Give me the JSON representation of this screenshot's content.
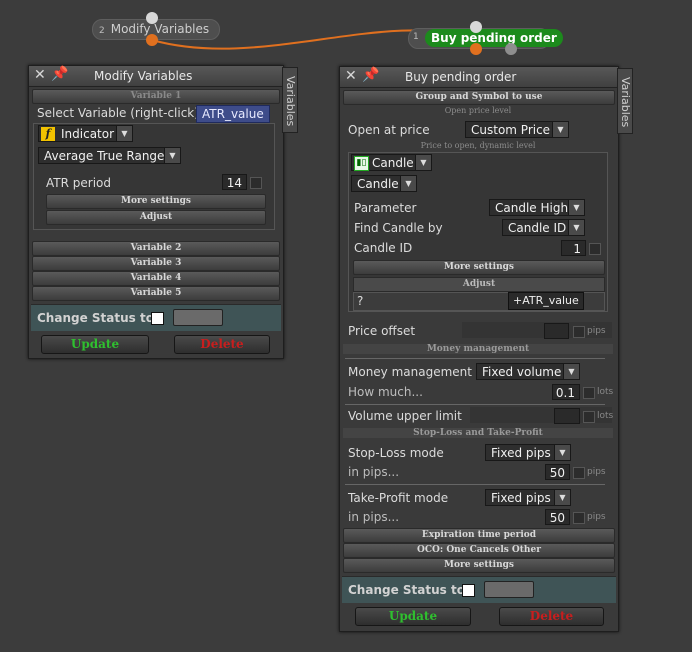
{
  "nodes": {
    "modify": {
      "number": "2",
      "label": "Modify Variables"
    },
    "buy": {
      "number": "1",
      "label": "Buy pending order"
    }
  },
  "modify_panel": {
    "title": "Modify Variables",
    "side_tab": "Variables",
    "var1_header": "Variable 1",
    "select_label": "Select Variable (right-click)",
    "selected_variable": "ATR_value",
    "source_dropdown": "Indicator",
    "indicator_dropdown": "Average True Range",
    "atr_period_label": "ATR period",
    "atr_period_value": "14",
    "more_settings": "More settings",
    "adjust": "Adjust",
    "variables": [
      "Variable 2",
      "Variable 3",
      "Variable 4",
      "Variable 5"
    ],
    "change_status_label": "Change Status to",
    "update_label": "Update",
    "delete_label": "Delete"
  },
  "buy_panel": {
    "title": "Buy pending order",
    "side_tab": "Variables",
    "group_symbol": "Group and Symbol to use",
    "open_price_level": "Open price level",
    "open_at_price_label": "Open at price",
    "open_at_price_value": "Custom Price",
    "price_hint": "Price to open, dynamic level",
    "candle_type": "Candle",
    "candle_dropdown": "Candle",
    "parameter_label": "Parameter",
    "parameter_value": "Candle High",
    "find_candle_label": "Find Candle by",
    "find_candle_value": "Candle ID",
    "candle_id_label": "Candle ID",
    "candle_id_value": "1",
    "more_settings": "More settings",
    "adjust": "Adjust",
    "adjust_op": "?",
    "adjust_value": "+ATR_value",
    "price_offset_label": "Price offset",
    "pips": "pips",
    "money_mgmt_header": "Money management",
    "money_mgmt_label": "Money management",
    "money_mgmt_value": "Fixed volume",
    "how_much_label": "How much...",
    "how_much_value": "0.1",
    "lots": "lots",
    "volume_upper_label": "Volume upper limit",
    "sltp_header": "Stop-Loss and Take-Profit",
    "sl_mode_label": "Stop-Loss mode",
    "sl_mode_value": "Fixed pips",
    "sl_pips_label": "in pips...",
    "sl_pips_value": "50",
    "tp_mode_label": "Take-Profit mode",
    "tp_mode_value": "Fixed pips",
    "tp_pips_label": "in pips...",
    "tp_pips_value": "50",
    "expiration": "Expiration time period",
    "oco": "OCO: One Cancels Other",
    "more_settings_2": "More settings",
    "change_status_label": "Change Status to",
    "update_label": "Update",
    "delete_label": "Delete"
  },
  "colors": {
    "update": "#2fc02f",
    "delete": "#c81e1e",
    "connection": "#e0701f",
    "active_node": "#1c8a1c"
  }
}
